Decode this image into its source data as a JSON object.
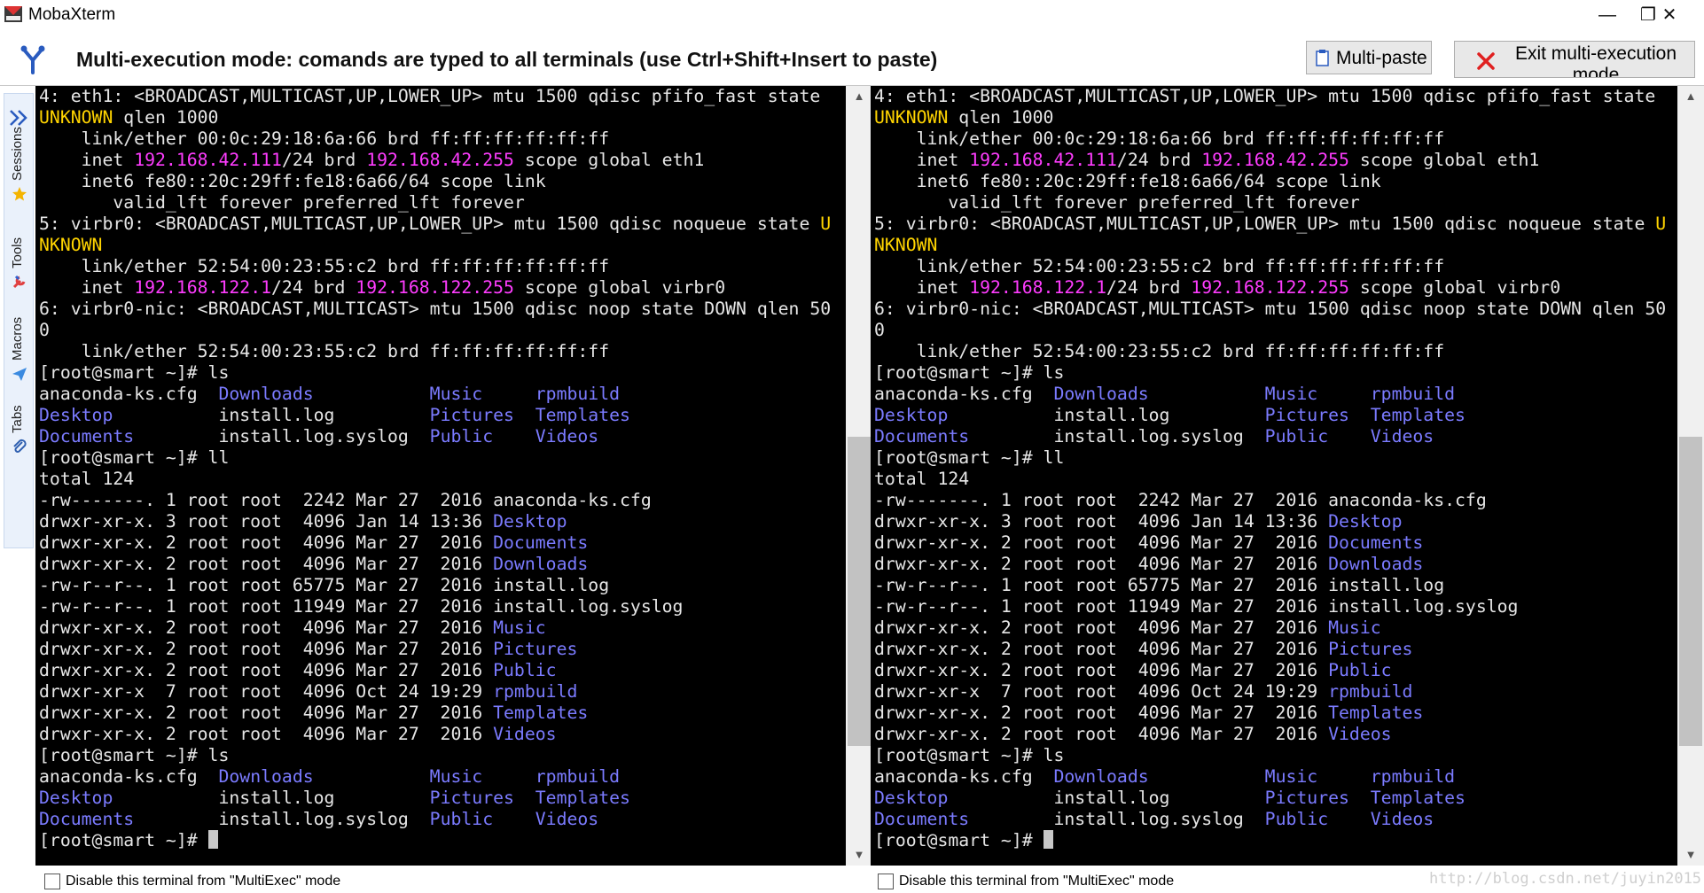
{
  "window": {
    "title": "MobaXterm",
    "controls": {
      "minimize": "—",
      "maximize": "❐",
      "close": "✕"
    }
  },
  "multiexec": {
    "message": "Multi-execution mode: comands are typed to all terminals (use Ctrl+Shift+Insert to paste)",
    "multipaste_label": "Multi-paste",
    "exit_label": "Exit multi-execution mode"
  },
  "sidebar": {
    "tabs": [
      {
        "label": "Sessions",
        "icon": "star-icon"
      },
      {
        "label": "Tools",
        "icon": "tools-icon"
      },
      {
        "label": "Macros",
        "icon": "paper-plane-icon"
      },
      {
        "label": "Tabs",
        "icon": "paperclip-icon"
      }
    ]
  },
  "colors": {
    "ip": "#ff3cff",
    "directory": "#7b7bff",
    "warning": "#ffd400",
    "terminal_bg": "#000000",
    "terminal_fg": "#e6e6e6"
  },
  "terminal_lines": [
    [
      [
        "4: eth1: <BROADCAST,MULTICAST,UP,LOWER_UP> mtu 1500 qdisc pfifo_fast state",
        ""
      ]
    ],
    [
      [
        "UNKNOWN",
        "y"
      ],
      [
        " qlen 1000",
        ""
      ]
    ],
    [
      [
        "    link/ether 00:0c:29:18:6a:66 brd ff:ff:ff:ff:ff:ff",
        ""
      ]
    ],
    [
      [
        "    inet ",
        ""
      ],
      [
        "192.168.42.111",
        "ip"
      ],
      [
        "/24 brd ",
        ""
      ],
      [
        "192.168.42.255",
        "ip"
      ],
      [
        " scope global eth1",
        ""
      ]
    ],
    [
      [
        "    inet6 fe80::20c:29ff:fe18:6a66/64 scope link",
        ""
      ]
    ],
    [
      [
        "       valid_lft forever preferred_lft forever",
        ""
      ]
    ],
    [
      [
        "5: virbr0: <BROADCAST,MULTICAST,UP,LOWER_UP> mtu 1500 qdisc noqueue state ",
        ""
      ],
      [
        "U",
        "y"
      ]
    ],
    [
      [
        "NKNOWN",
        "y"
      ]
    ],
    [
      [
        "    link/ether 52:54:00:23:55:c2 brd ff:ff:ff:ff:ff:ff",
        ""
      ]
    ],
    [
      [
        "    inet ",
        ""
      ],
      [
        "192.168.122.1",
        "ip"
      ],
      [
        "/24 brd ",
        ""
      ],
      [
        "192.168.122.255",
        "ip"
      ],
      [
        " scope global virbr0",
        ""
      ]
    ],
    [
      [
        "6: virbr0-nic: <BROADCAST,MULTICAST> mtu 1500 qdisc noop state DOWN qlen 50",
        ""
      ]
    ],
    [
      [
        "0",
        ""
      ]
    ],
    [
      [
        "    link/ether 52:54:00:23:55:c2 brd ff:ff:ff:ff:ff:ff",
        ""
      ]
    ],
    [
      [
        "[root@smart ~]# ls",
        ""
      ]
    ],
    [
      [
        "anaconda-ks.cfg  ",
        ""
      ],
      [
        "Downloads",
        "d"
      ],
      [
        "           ",
        ""
      ],
      [
        "Music",
        "d"
      ],
      [
        "     ",
        ""
      ],
      [
        "rpmbuild",
        "d"
      ]
    ],
    [
      [
        "Desktop",
        "d"
      ],
      [
        "          install.log         ",
        ""
      ],
      [
        "Pictures",
        "d"
      ],
      [
        "  ",
        ""
      ],
      [
        "Templates",
        "d"
      ]
    ],
    [
      [
        "Documents",
        "d"
      ],
      [
        "        install.log.syslog  ",
        ""
      ],
      [
        "Public",
        "d"
      ],
      [
        "    ",
        ""
      ],
      [
        "Videos",
        "d"
      ]
    ],
    [
      [
        "[root@smart ~]# ll",
        ""
      ]
    ],
    [
      [
        "total 124",
        ""
      ]
    ],
    [
      [
        "-rw-------. 1 root root  2242 Mar 27  2016 anaconda-ks.cfg",
        ""
      ]
    ],
    [
      [
        "drwxr-xr-x. 3 root root  4096 Jan 14 13:36 ",
        ""
      ],
      [
        "Desktop",
        "d"
      ]
    ],
    [
      [
        "drwxr-xr-x. 2 root root  4096 Mar 27  2016 ",
        ""
      ],
      [
        "Documents",
        "d"
      ]
    ],
    [
      [
        "drwxr-xr-x. 2 root root  4096 Mar 27  2016 ",
        ""
      ],
      [
        "Downloads",
        "d"
      ]
    ],
    [
      [
        "-rw-r--r--. 1 root root 65775 Mar 27  2016 install.log",
        ""
      ]
    ],
    [
      [
        "-rw-r--r--. 1 root root 11949 Mar 27  2016 install.log.syslog",
        ""
      ]
    ],
    [
      [
        "drwxr-xr-x. 2 root root  4096 Mar 27  2016 ",
        ""
      ],
      [
        "Music",
        "d"
      ]
    ],
    [
      [
        "drwxr-xr-x. 2 root root  4096 Mar 27  2016 ",
        ""
      ],
      [
        "Pictures",
        "d"
      ]
    ],
    [
      [
        "drwxr-xr-x. 2 root root  4096 Mar 27  2016 ",
        ""
      ],
      [
        "Public",
        "d"
      ]
    ],
    [
      [
        "drwxr-xr-x  7 root root  4096 Oct 24 19:29 ",
        ""
      ],
      [
        "rpmbuild",
        "d"
      ]
    ],
    [
      [
        "drwxr-xr-x. 2 root root  4096 Mar 27  2016 ",
        ""
      ],
      [
        "Templates",
        "d"
      ]
    ],
    [
      [
        "drwxr-xr-x. 2 root root  4096 Mar 27  2016 ",
        ""
      ],
      [
        "Videos",
        "d"
      ]
    ],
    [
      [
        "[root@smart ~]# ls",
        ""
      ]
    ],
    [
      [
        "anaconda-ks.cfg  ",
        ""
      ],
      [
        "Downloads",
        "d"
      ],
      [
        "           ",
        ""
      ],
      [
        "Music",
        "d"
      ],
      [
        "     ",
        ""
      ],
      [
        "rpmbuild",
        "d"
      ]
    ],
    [
      [
        "Desktop",
        "d"
      ],
      [
        "          install.log         ",
        ""
      ],
      [
        "Pictures",
        "d"
      ],
      [
        "  ",
        ""
      ],
      [
        "Templates",
        "d"
      ]
    ],
    [
      [
        "Documents",
        "d"
      ],
      [
        "        install.log.syslog  ",
        ""
      ],
      [
        "Public",
        "d"
      ],
      [
        "    ",
        ""
      ],
      [
        "Videos",
        "d"
      ]
    ],
    [
      [
        "[root@smart ~]# ",
        ""
      ],
      [
        "",
        "cursor"
      ]
    ]
  ],
  "terminals": [
    {
      "disable_label": "Disable this terminal from \"MultiExec\" mode",
      "scroll_position": 0.48
    },
    {
      "disable_label": "Disable this terminal from \"MultiExec\" mode",
      "scroll_position": 0.48
    }
  ],
  "watermark": "http://blog.csdn.net/juyin2015"
}
